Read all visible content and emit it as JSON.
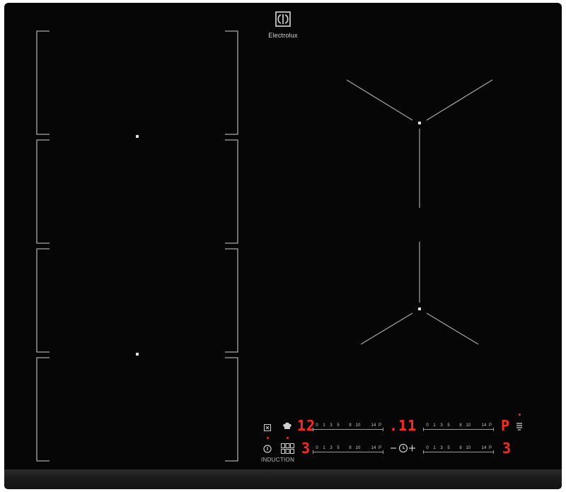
{
  "brand": {
    "name": "Electrolux",
    "logo_icon": "electrolux-logo-icon"
  },
  "colors": {
    "glass": "#060606",
    "zone_lines": "#a8a8a8",
    "display_red": "#ff2a1f"
  },
  "zones": {
    "left": "bridge-zones-4",
    "right": "flex-zones-2"
  },
  "controls": {
    "row1": {
      "left_display": "12",
      "right_display": ".11",
      "end_display": "P",
      "left_slider_ticks": [
        "0",
        "1",
        "3",
        "5",
        "8",
        "10",
        "14",
        "P"
      ],
      "right_slider_ticks": [
        "0",
        "1",
        "3",
        "5",
        "8",
        "10",
        "14",
        "P"
      ]
    },
    "row2": {
      "left_display": "3",
      "end_display": "3",
      "left_slider_ticks": [
        "0",
        "1",
        "3",
        "5",
        "8",
        "10",
        "14",
        "P"
      ],
      "right_slider_ticks": [
        "0",
        "1",
        "3",
        "5",
        "8",
        "10",
        "14",
        "P"
      ],
      "induction_label": "INDUCTION"
    },
    "icons": [
      "lock-icon",
      "chef-hat-icon",
      "power-icon",
      "zone-select-icon",
      "timer-icon",
      "hob-hood-icon"
    ]
  }
}
